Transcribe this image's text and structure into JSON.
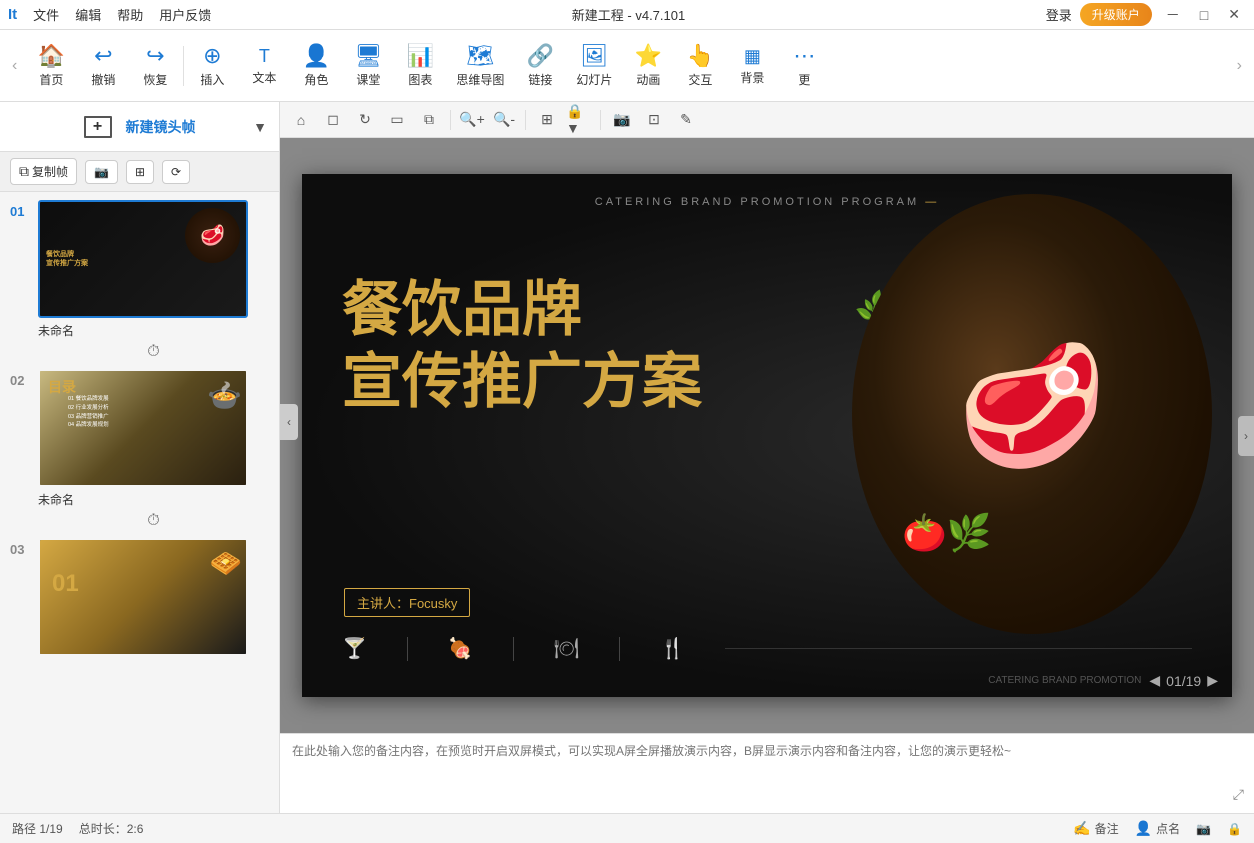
{
  "titlebar": {
    "app_letter": "It",
    "menus": [
      "文件",
      "编辑",
      "帮助",
      "用户反馈"
    ],
    "title": "新建工程 - v4.7.101",
    "login": "登录",
    "upgrade": "升级账户",
    "win_min": "－",
    "win_restore": "□",
    "win_close": "✕"
  },
  "toolbar": {
    "nav_left": "‹",
    "nav_right": "›",
    "home": "首页",
    "undo": "撤销",
    "redo": "恢复",
    "insert": "插入",
    "text": "文本",
    "character": "角色",
    "classroom": "课堂",
    "chart": "图表",
    "mindmap": "思维导图",
    "link": "链接",
    "slideshow": "幻灯片",
    "animation": "动画",
    "interact": "交互",
    "background": "背景",
    "more": "更",
    "more_arrow": "›"
  },
  "leftpanel": {
    "new_frame": "新建镜头帧",
    "copy_frame": "复制帧",
    "camera_btn": "📷",
    "transform_btn": "⊞",
    "path_btn": "⟳",
    "slides": [
      {
        "number": "01",
        "label": "未命名",
        "active": true
      },
      {
        "number": "02",
        "label": "未命名",
        "active": false
      },
      {
        "number": "03",
        "label": "",
        "active": false
      }
    ]
  },
  "canvas_toolbar": {
    "tools": [
      "⌂",
      "◻",
      "◻",
      "◻",
      "◻",
      "◻",
      "🔍+",
      "🔍-",
      "⊞",
      "🔒",
      "📷",
      "⊡",
      "✎"
    ]
  },
  "slide": {
    "top_text": "CATERING BRAND PROMOTION PROGRAM",
    "main_title_line1": "餐饮品牌",
    "main_title_line2": "宣传推广方案",
    "presenter": "主讲人：Focusky",
    "bottom_text": "CATERING BRAND PROMOTION",
    "page_info": "01/19",
    "icons": [
      "🍸",
      "🍖",
      "menu",
      "🍴"
    ]
  },
  "notes": {
    "placeholder": "在此处输入您的备注内容，在预览时开启双屏模式，可以实现A屏全屏播放演示内容，B屏显示演示内容和备注内容，让您的演示更轻松~"
  },
  "statusbar": {
    "path": "路径 1/19",
    "duration": "总时长：2:6",
    "notes_btn": "备注",
    "rollcall_btn": "点名",
    "record_btn": "📹",
    "lock_btn": "🔒"
  }
}
